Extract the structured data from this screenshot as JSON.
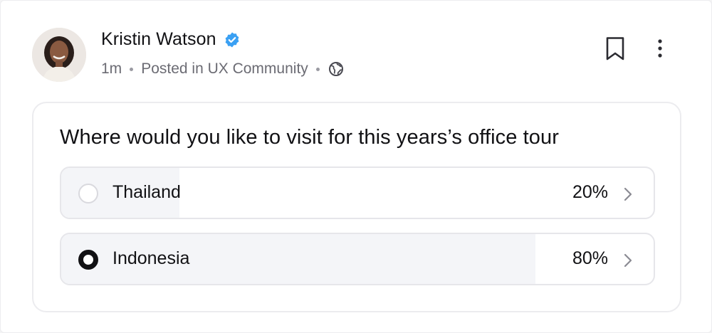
{
  "post": {
    "author_name": "Kristin Watson",
    "time": "1m",
    "posted_in": "Posted in UX Community",
    "verified_icon": "verified-badge-icon",
    "visibility_icon": "globe-icon"
  },
  "actions": {
    "bookmark_icon": "bookmark-icon",
    "more_icon": "more-vertical-icon"
  },
  "poll": {
    "question": "Where would you like to visit for this years’s office tour",
    "options": [
      {
        "label": "Thailand",
        "percent_label": "20%",
        "percent": 20,
        "selected": false
      },
      {
        "label": "Indonesia",
        "percent_label": "80%",
        "percent": 80,
        "selected": true
      }
    ]
  },
  "colors": {
    "verified": "#3aa0f3",
    "text": "#111114",
    "muted": "#6b6b73",
    "fill": "#f4f5f8"
  }
}
